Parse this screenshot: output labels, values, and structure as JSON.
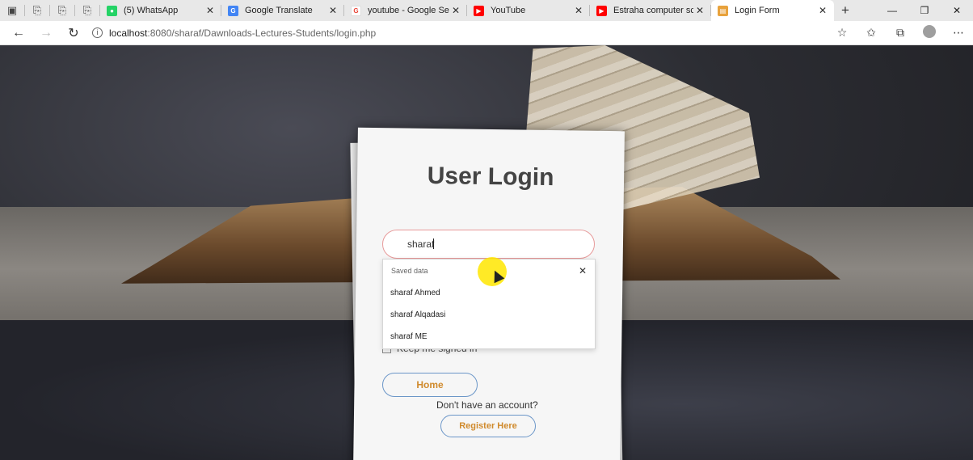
{
  "browser": {
    "tabs": [
      {
        "title": "(5) WhatsApp",
        "icon": "whatsapp-icon",
        "color": "#25d366"
      },
      {
        "title": "Google Translate",
        "icon": "translate-icon",
        "color": "#4285f4"
      },
      {
        "title": "youtube - Google Search",
        "icon": "google-icon",
        "color": "#ea4335"
      },
      {
        "title": "YouTube",
        "icon": "youtube-icon",
        "color": "#ff0000"
      },
      {
        "title": "Estraha computer science",
        "icon": "youtube-icon",
        "color": "#ff0000"
      },
      {
        "title": "Login Form",
        "icon": "page-icon",
        "color": "#e8a23c"
      }
    ],
    "url_host": "localhost",
    "url_path": ":8080/sharaf/Dawnloads-Lectures-Students/login.php"
  },
  "login": {
    "title": "User Login",
    "username_value": "sharaf",
    "autofill_header": "Saved data",
    "autofill_items": [
      "sharaf Ahmed",
      "sharaf Alqadasi",
      "sharaf ME"
    ],
    "keep_signed_in": "Keep me signed in",
    "home_label": "Home",
    "no_account": "Don't have an account?",
    "register_label": "Register Here"
  }
}
